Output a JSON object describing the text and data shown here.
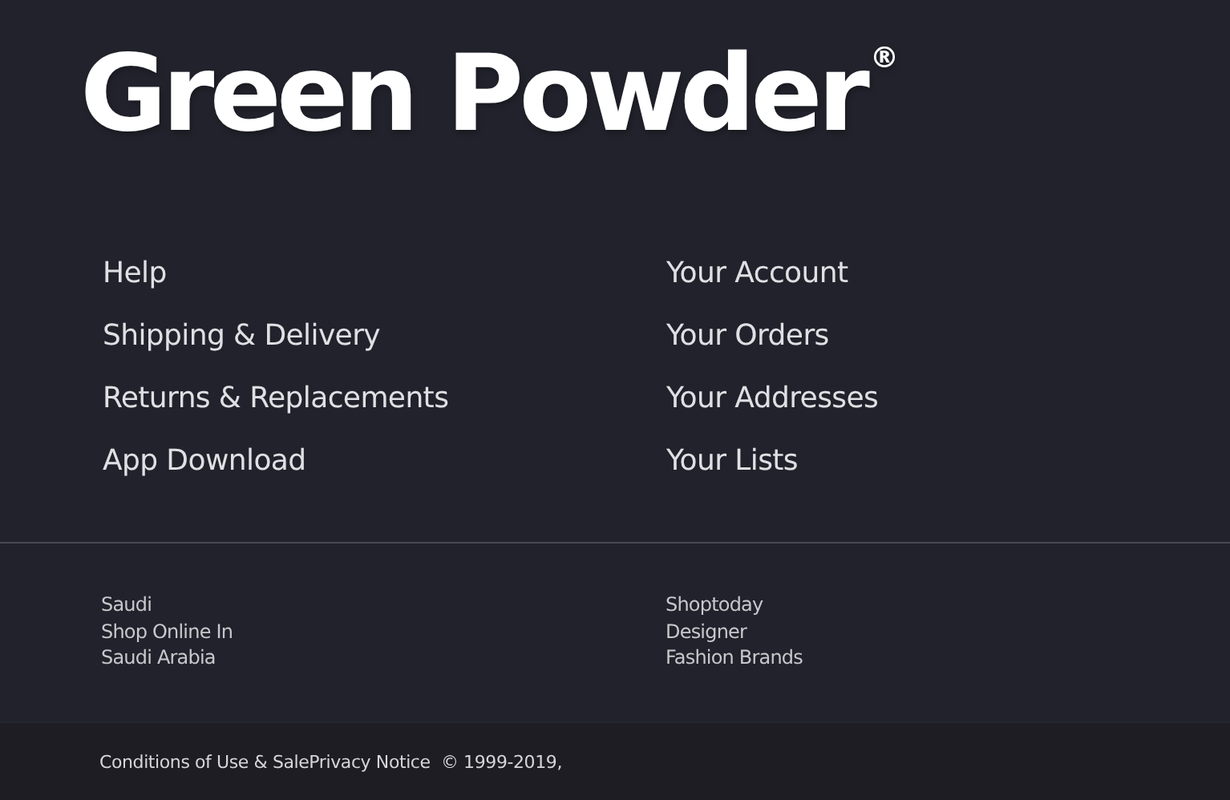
{
  "logo": {
    "text": "Green Powder$^{®}$"
  },
  "links": {
    "columns": [
      [
        "Help",
        "Shipping & Delivery",
        "Returns & Replacements",
        "App Download"
      ],
      [
        "Your Account",
        "Your Orders",
        "Your Addresses",
        "Your Lists"
      ]
    ]
  },
  "regions": [
    [
      "Saudi",
      "Shop Online In",
      "Saudi Arabia"
    ],
    [
      "Shoptoday",
      "Designer",
      "Fashion Brands"
    ]
  ],
  "footer": {
    "text": "Conditions of Use & SalePrivacy Notice  © 1999-2019,"
  }
}
